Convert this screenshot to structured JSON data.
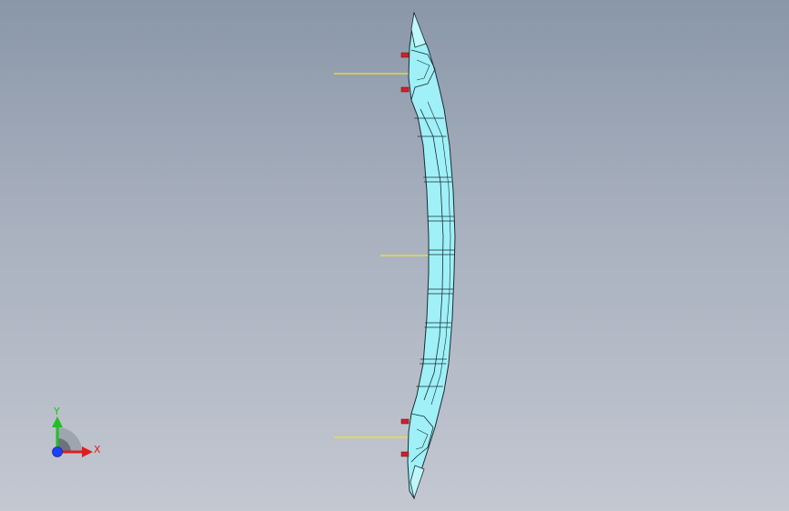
{
  "viewport": {
    "background_top": "#8a97a8",
    "background_bottom": "#c3c8d1"
  },
  "part": {
    "fill": "#9ff0f7",
    "edge": "#1d2b33",
    "pin_color": "#d0202a",
    "guide_color": "#e8e830"
  },
  "triad": {
    "x_label": "X",
    "y_label": "Y",
    "x_color": "#e01e1e",
    "y_color": "#21c021",
    "z_color": "#1f3fff"
  }
}
